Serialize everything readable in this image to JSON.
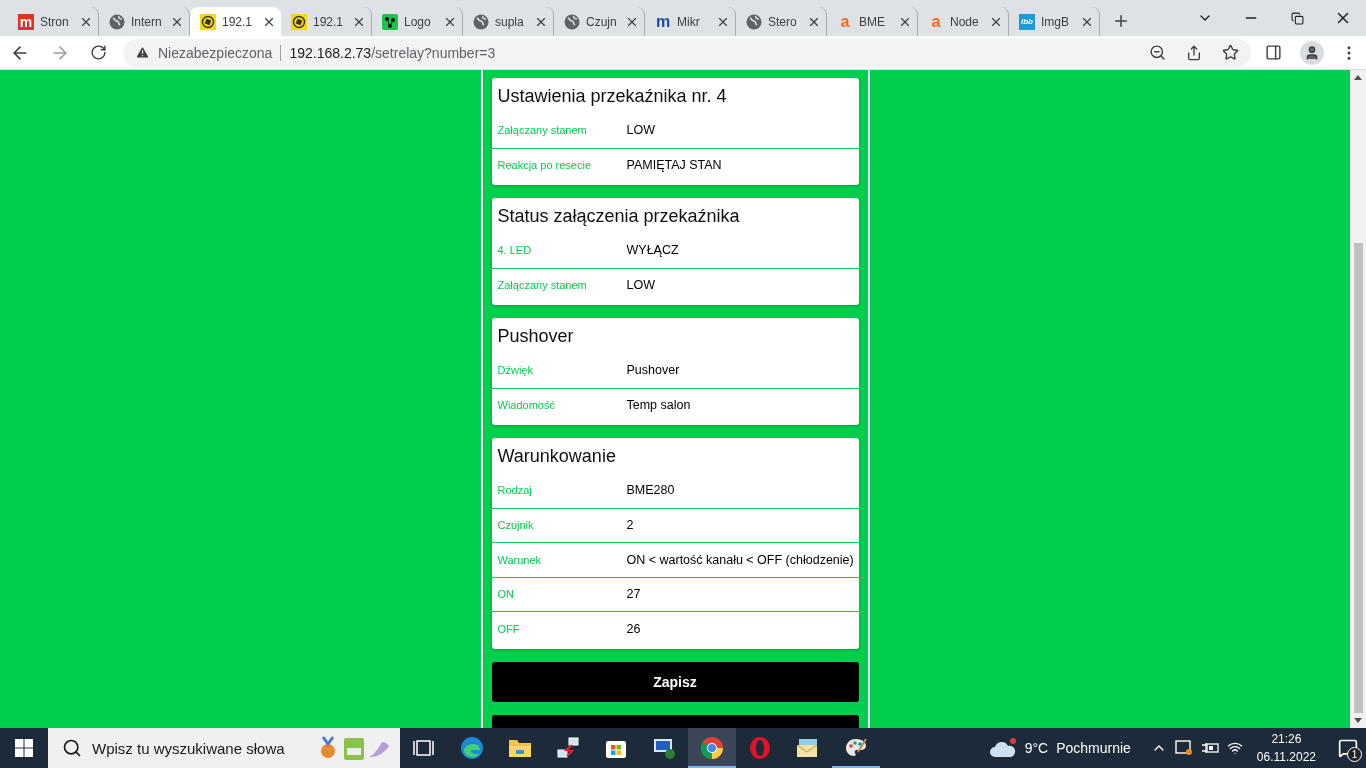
{
  "browser": {
    "tabs": [
      {
        "title": "Stron",
        "kind": "letter",
        "glyph": "m",
        "color": "#e8301c",
        "selected": false
      },
      {
        "title": "Intern",
        "kind": "globe",
        "selected": false
      },
      {
        "title": "192.1",
        "kind": "badge",
        "selected": true
      },
      {
        "title": "192.1",
        "kind": "badge",
        "selected": false
      },
      {
        "title": "Logo",
        "kind": "graph",
        "selected": false
      },
      {
        "title": "supla",
        "kind": "globe",
        "selected": false
      },
      {
        "title": "Czujn",
        "kind": "globe",
        "selected": false
      },
      {
        "title": "Mikr",
        "kind": "letter",
        "glyph": "m",
        "color": "#1a4fa0",
        "selected": false
      },
      {
        "title": "Stero",
        "kind": "globe",
        "selected": false
      },
      {
        "title": "BME",
        "kind": "letter",
        "glyph": "a",
        "color": "#ff6a13",
        "selected": false
      },
      {
        "title": "Node",
        "kind": "letter",
        "glyph": "a",
        "color": "#ff6a13",
        "selected": false
      },
      {
        "title": "ImgB",
        "kind": "tile",
        "glyph": "ibb",
        "color": "#1c9ad6",
        "selected": false
      }
    ],
    "address": {
      "security": "Niezabezpieczona",
      "host": "192.168.2.73",
      "path": "/setrelay?number=3"
    }
  },
  "sections": [
    {
      "title": "Ustawienia przekaźnika nr. 4",
      "rows": [
        {
          "label": "Załączany stanem",
          "value": "LOW"
        },
        {
          "label": "Reakcja po resecie",
          "value": "PAMIĘTAJ STAN"
        }
      ]
    },
    {
      "title": "Status załączenia przekaźnika",
      "rows": [
        {
          "label": "4. LED",
          "value": "WYŁĄCZ"
        },
        {
          "label": "Załączany stanem",
          "value": "LOW"
        }
      ]
    },
    {
      "title": "Pushover",
      "rows": [
        {
          "label": "Dźwięk",
          "value": "Pushover"
        },
        {
          "label": "Wiadomość",
          "value": "Temp salon"
        }
      ]
    },
    {
      "title": "Warunkowanie",
      "rows": [
        {
          "label": "Rodzaj",
          "value": "BME280"
        },
        {
          "label": "Czujnik",
          "value": "2"
        },
        {
          "label": "Warunek",
          "value": "ON < wartość kanału < OFF (chłodzenie)"
        },
        {
          "label": "ON",
          "value": "27"
        },
        {
          "label": "OFF",
          "value": "26"
        }
      ]
    }
  ],
  "buttons": [
    {
      "kind": "labeled",
      "label": "Zapisz"
    },
    {
      "kind": "partial"
    }
  ],
  "taskbar": {
    "search": {
      "placeholder": "Wpisz tu wyszukiwane słowa"
    },
    "apps": [
      {
        "kind": "taskview",
        "selected": false,
        "running": false
      },
      {
        "kind": "edge",
        "selected": false,
        "running": false
      },
      {
        "kind": "folder",
        "selected": false,
        "running": false
      },
      {
        "kind": "remote",
        "selected": false,
        "running": false
      },
      {
        "kind": "store",
        "selected": false,
        "running": false
      },
      {
        "kind": "network",
        "selected": false,
        "running": false
      },
      {
        "kind": "chrome",
        "selected": true,
        "running": true
      },
      {
        "kind": "opera",
        "selected": false,
        "running": false
      },
      {
        "kind": "mail",
        "selected": false,
        "running": false
      },
      {
        "kind": "paint",
        "selected": false,
        "running": true
      }
    ],
    "weather": {
      "temperature": "9°C",
      "condition": "Pochmurnie"
    },
    "time": "21:26",
    "date": "06.11.2022",
    "notifications": "1"
  }
}
